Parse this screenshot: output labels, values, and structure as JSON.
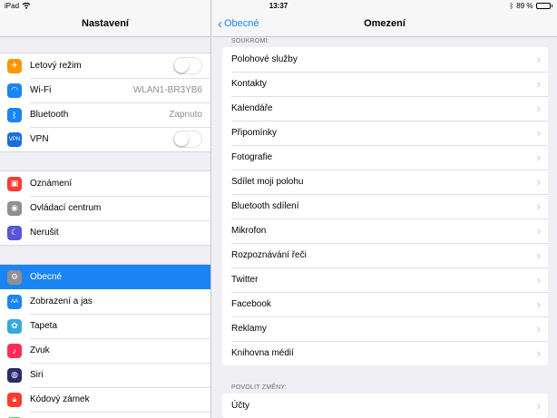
{
  "status": {
    "device": "iPad",
    "time": "13:37",
    "battery": "89 %",
    "battery_level": 0.89
  },
  "master": {
    "title": "Nastavení",
    "groups": [
      [
        {
          "label": "Letový režim",
          "icon": "airplane-icon",
          "color": "#ff9500",
          "glyph": "✈",
          "accessory": "toggle",
          "on": false
        },
        {
          "label": "Wi-Fi",
          "icon": "wifi-icon",
          "color": "#1a84f5",
          "glyph": "◠",
          "detail": "WLAN1-BR3YB6"
        },
        {
          "label": "Bluetooth",
          "icon": "bluetooth-icon",
          "color": "#1a84f5",
          "glyph": "ᛒ",
          "detail": "Zapnuto"
        },
        {
          "label": "VPN",
          "icon": "vpn-icon",
          "color": "#1a6ed8",
          "glyph": "VPN",
          "accessory": "toggle",
          "on": false
        }
      ],
      [
        {
          "label": "Oznámení",
          "icon": "notifications-icon",
          "color": "#ff3b30",
          "glyph": "▣"
        },
        {
          "label": "Ovládací centrum",
          "icon": "control-center-icon",
          "color": "#8e8e93",
          "glyph": "◉"
        },
        {
          "label": "Nerušit",
          "icon": "do-not-disturb-icon",
          "color": "#5856d6",
          "glyph": "☾"
        }
      ],
      [
        {
          "label": "Obecné",
          "icon": "gear-icon",
          "color": "#8e8e93",
          "glyph": "⚙",
          "selected": true
        },
        {
          "label": "Zobrazení a jas",
          "icon": "display-brightness-icon",
          "color": "#1a84f5",
          "glyph": "AA"
        },
        {
          "label": "Tapeta",
          "icon": "wallpaper-icon",
          "color": "#34aadc",
          "glyph": "✿"
        },
        {
          "label": "Zvuk",
          "icon": "sound-icon",
          "color": "#ff2d55",
          "glyph": "♪"
        },
        {
          "label": "Siri",
          "icon": "siri-icon",
          "color": "#2c2c6c",
          "glyph": "◍"
        },
        {
          "label": "Kódový zámek",
          "icon": "passcode-lock-icon",
          "color": "#ff3b30",
          "glyph": "🔒︎"
        },
        {
          "label": "",
          "icon": "battery-icon",
          "color": "#4cd964",
          "glyph": ""
        }
      ]
    ]
  },
  "detail": {
    "back_label": "Obecné",
    "title": "Omezení",
    "privacy_header": "SOUKROMÍ:",
    "privacy_items": [
      "Polohové služby",
      "Kontakty",
      "Kalendáře",
      "Připomínky",
      "Fotografie",
      "Sdílet moji polohu",
      "Bluetooth sdílení",
      "Mikrofon",
      "Rozpoznávání řeči",
      "Twitter",
      "Facebook",
      "Reklamy",
      "Knihovna médií"
    ],
    "allow_header": "POVOLIT ZMĚNY:",
    "allow_items": [
      "Účty"
    ]
  }
}
